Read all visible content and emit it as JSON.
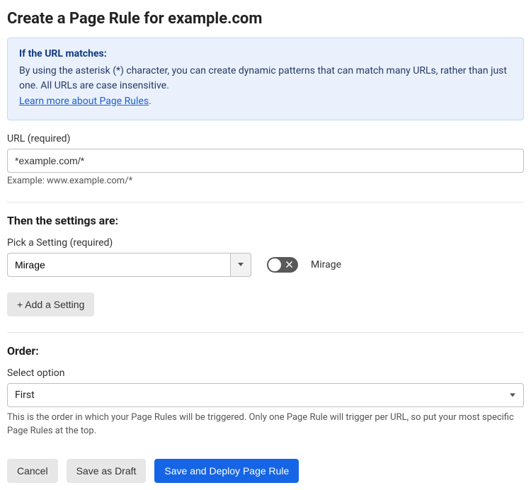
{
  "page_title": "Create a Page Rule for example.com",
  "info": {
    "title": "If the URL matches:",
    "body": "By using the asterisk (*) character, you can create dynamic patterns that can match many URLs, rather than just one. All URLs are case insensitive.",
    "link_text": "Learn more about Page Rules",
    "period": "."
  },
  "url_section": {
    "label": "URL (required)",
    "value": "*example.com/*",
    "example": "Example: www.example.com/*"
  },
  "settings_section": {
    "title": "Then the settings are:",
    "pick_label": "Pick a Setting (required)",
    "selected_setting": "Mirage",
    "toggle_label": "Mirage",
    "toggle_on": false,
    "add_button": "+ Add a Setting"
  },
  "order_section": {
    "title": "Order:",
    "select_label": "Select option",
    "selected": "First",
    "hint": "This is the order in which your Page Rules will be triggered. Only one Page Rule will trigger per URL, so put your most specific Page Rules at the top."
  },
  "actions": {
    "cancel": "Cancel",
    "save_draft": "Save as Draft",
    "save_deploy": "Save and Deploy Page Rule"
  }
}
